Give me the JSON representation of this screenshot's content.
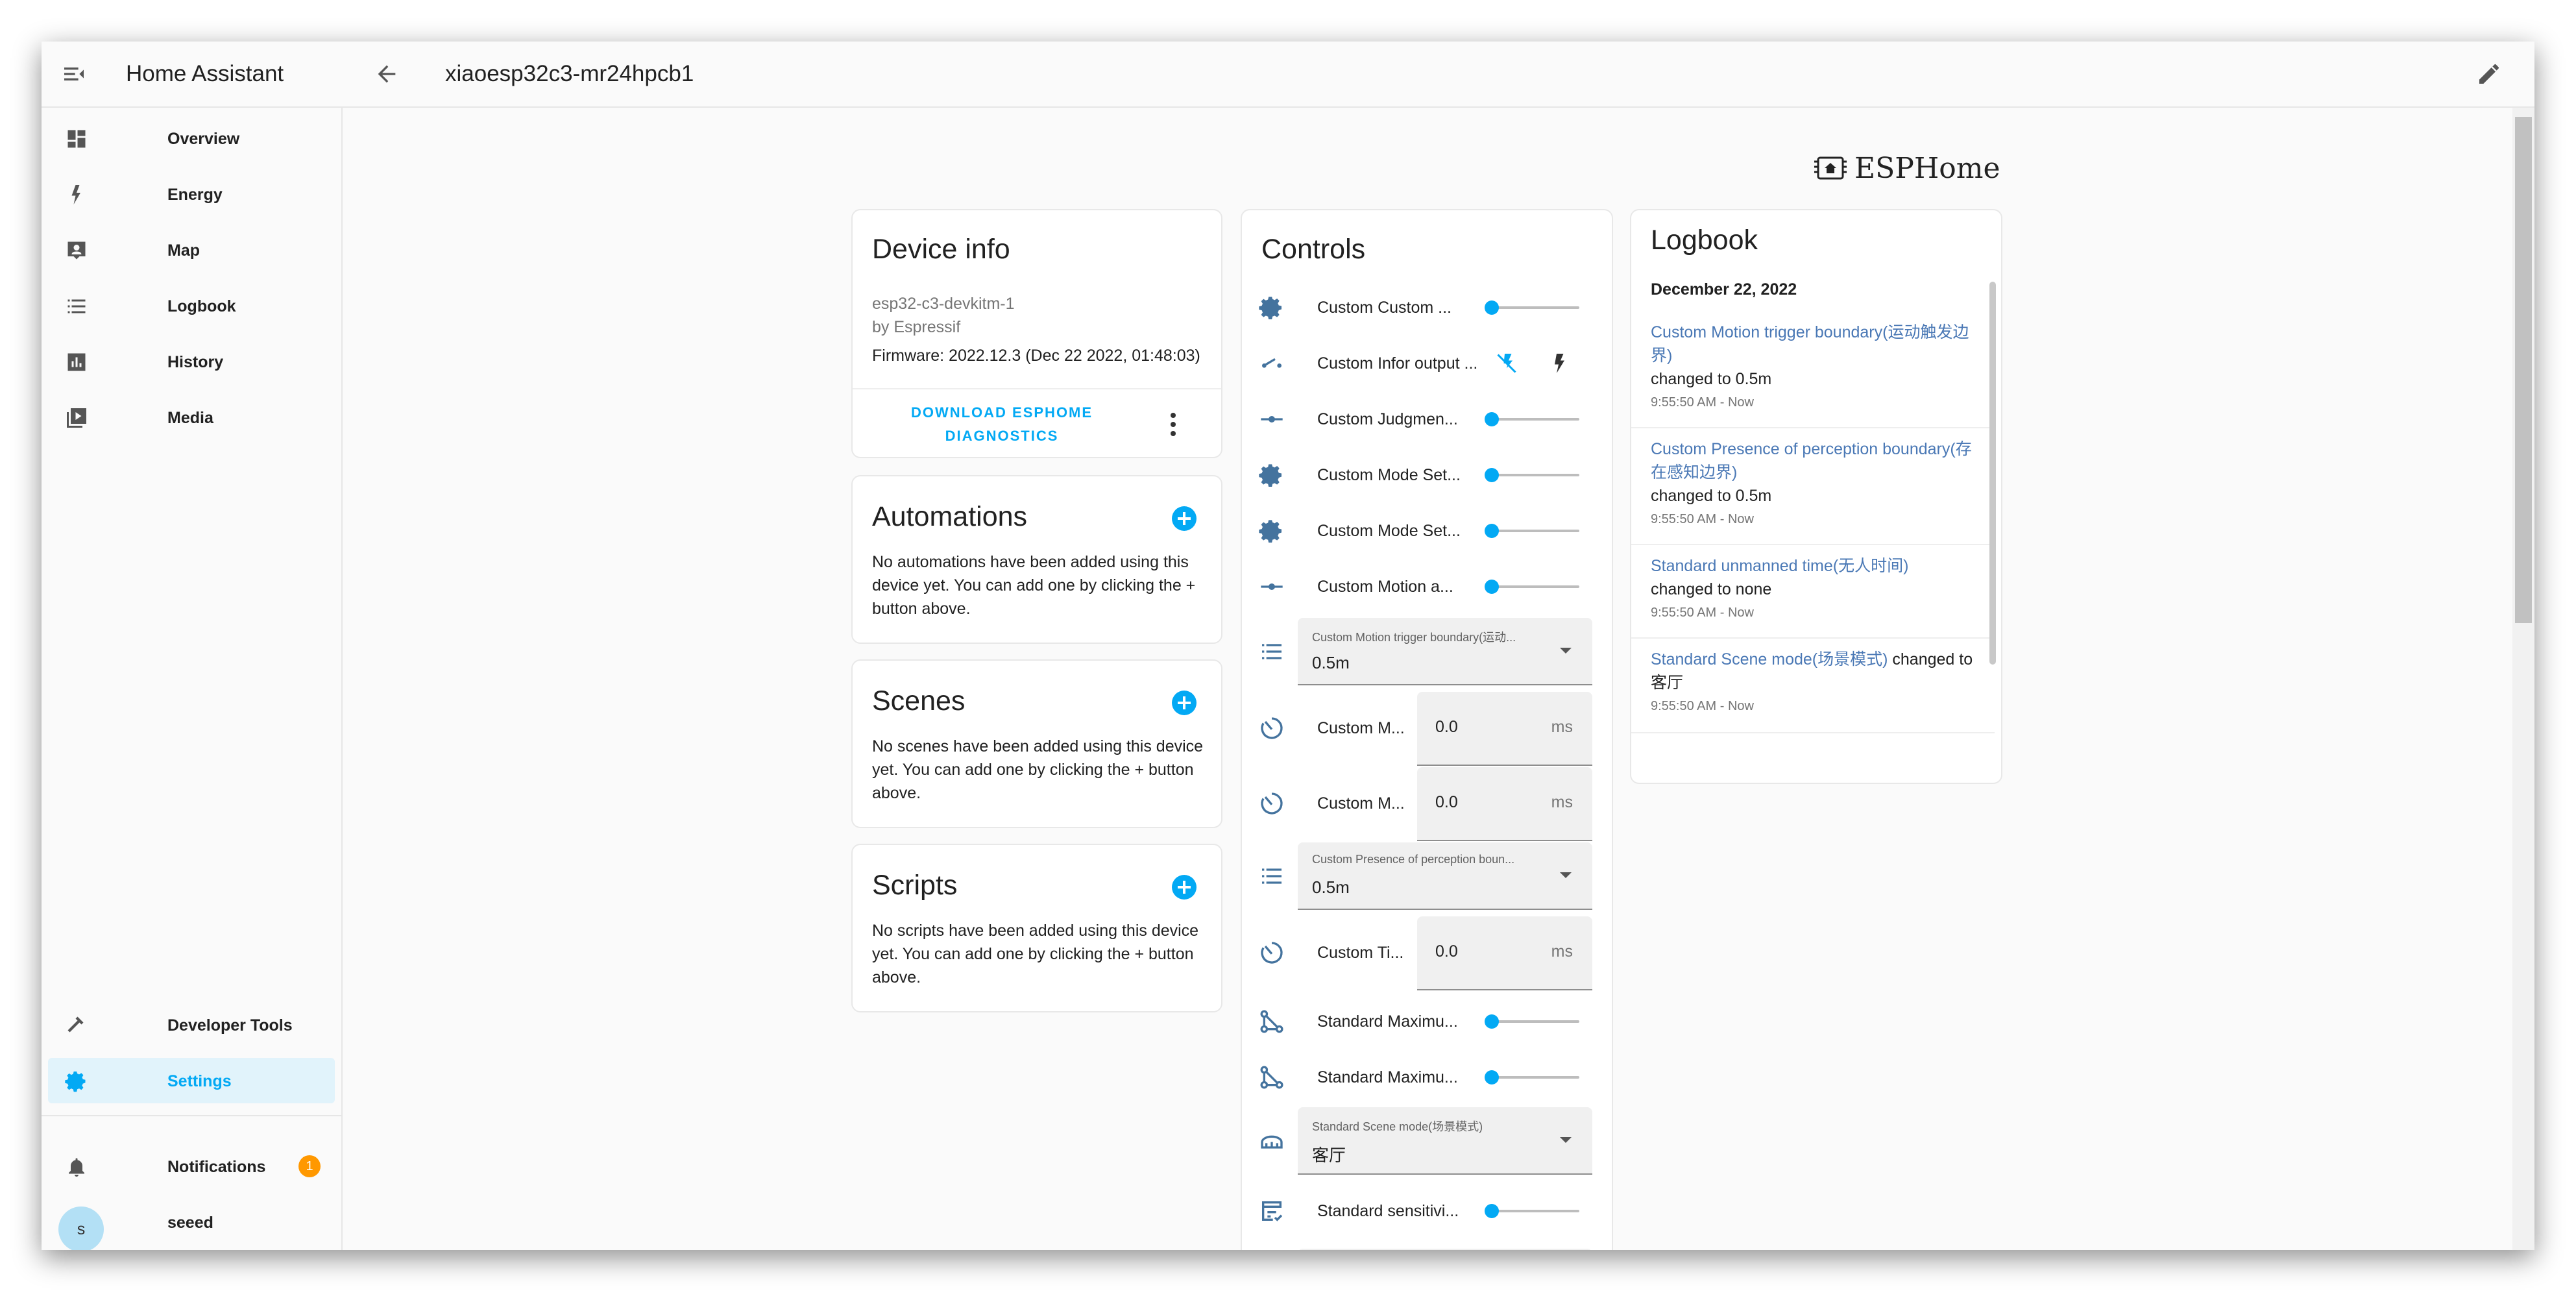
{
  "app": {
    "title": "Home Assistant"
  },
  "header": {
    "title": "xiaoesp32c3-mr24hpcb1"
  },
  "sidebar": {
    "items": [
      {
        "label": "Overview",
        "icon": "overview-icon"
      },
      {
        "label": "Energy",
        "icon": "energy-icon"
      },
      {
        "label": "Map",
        "icon": "map-icon"
      },
      {
        "label": "Logbook",
        "icon": "logbook-icon"
      },
      {
        "label": "History",
        "icon": "history-icon"
      },
      {
        "label": "Media",
        "icon": "media-icon"
      }
    ],
    "bottom": [
      {
        "label": "Developer Tools",
        "icon": "hammer-icon"
      },
      {
        "label": "Settings",
        "icon": "gear-icon",
        "active": true
      }
    ],
    "notifications": {
      "label": "Notifications",
      "count": "1"
    },
    "user": {
      "name": "seeed",
      "initial": "s"
    }
  },
  "brand": {
    "text": "ESPHome"
  },
  "device_info": {
    "title": "Device info",
    "model": "esp32-c3-devkitm-1",
    "manufacturer": "by Espressif",
    "firmware": "Firmware: 2022.12.3 (Dec 22 2022, 01:48:03)",
    "download_line1": "DOWNLOAD ESPHOME",
    "download_line2": "DIAGNOSTICS"
  },
  "automations": {
    "title": "Automations",
    "line1": "No automations have been added using this",
    "line2": "device yet. You can add one by clicking the +",
    "line3": "button above."
  },
  "scenes": {
    "title": "Scenes",
    "line1": "No scenes have been added using this device",
    "line2": "yet. You can add one by clicking the + button",
    "line3": "above."
  },
  "scripts": {
    "title": "Scripts",
    "line1": "No scripts have been added using this device",
    "line2": "yet. You can add one by clicking the + button",
    "line3": "above."
  },
  "controls": {
    "title": "Controls",
    "items": [
      {
        "label": "Custom Custom ...",
        "kind": "slider",
        "icon": "gear-icon",
        "value": 0
      },
      {
        "label": "Custom Infor output ...",
        "kind": "toggle",
        "icon": "switch-icon"
      },
      {
        "label": "Custom Judgmen...",
        "kind": "slider",
        "icon": "ray-vertex-icon",
        "value": 0
      },
      {
        "label": "Custom Mode Set...",
        "kind": "slider",
        "icon": "gear-icon",
        "value": 0
      },
      {
        "label": "Custom Mode Set...",
        "kind": "slider",
        "icon": "gear-icon",
        "value": 0
      },
      {
        "label": "Custom Motion a...",
        "kind": "slider",
        "icon": "ray-vertex-icon",
        "value": 0
      },
      {
        "label": "Custom Motion trigger boundary(运动...",
        "kind": "select",
        "icon": "list-icon",
        "value": "0.5m"
      },
      {
        "label": "Custom M...",
        "kind": "number",
        "icon": "timer-icon",
        "value": "0.0",
        "unit": "ms"
      },
      {
        "label": "Custom M...",
        "kind": "number",
        "icon": "timer-icon",
        "value": "0.0",
        "unit": "ms"
      },
      {
        "label": "Custom Presence of perception boun...",
        "kind": "select",
        "icon": "list-icon",
        "value": "0.5m"
      },
      {
        "label": "Custom Ti...",
        "kind": "number",
        "icon": "timer-icon",
        "value": "0.0",
        "unit": "ms"
      },
      {
        "label": "Standard Maximu...",
        "kind": "slider",
        "icon": "vector-icon",
        "value": 0
      },
      {
        "label": "Standard Maximu...",
        "kind": "slider",
        "icon": "vector-icon",
        "value": 0
      },
      {
        "label": "Standard Scene mode(场景模式)",
        "kind": "select",
        "icon": "sofa-icon",
        "value": "客厅"
      },
      {
        "label": "Standard sensitivi...",
        "kind": "slider",
        "icon": "sensitivity-icon",
        "value": 0
      }
    ]
  },
  "logbook": {
    "title": "Logbook",
    "date": "December 22, 2022",
    "entries": [
      {
        "name_l1": "Custom Motion trigger boundary(运动触发边",
        "name_l2": "界)",
        "text": "changed to 0.5m",
        "time": "9:55:50 AM - Now"
      },
      {
        "name_l1": "Custom Presence of perception boundary(存",
        "name_l2": "在感知边界)",
        "text": "changed to 0.5m",
        "time": "9:55:50 AM - Now"
      },
      {
        "name_l1": "Standard unmanned time(无人时间)",
        "text": "changed to none",
        "time": "9:55:50 AM - Now"
      },
      {
        "name_l1": "Standard Scene mode(场景模式)",
        "text_inline": " changed to",
        "text": "客厅",
        "time": "9:55:50 AM - Now"
      }
    ]
  },
  "colors": {
    "accent": "#03a9f4",
    "badge": "#ff9800",
    "link": "#4a78b5",
    "icon": "#44739e"
  }
}
